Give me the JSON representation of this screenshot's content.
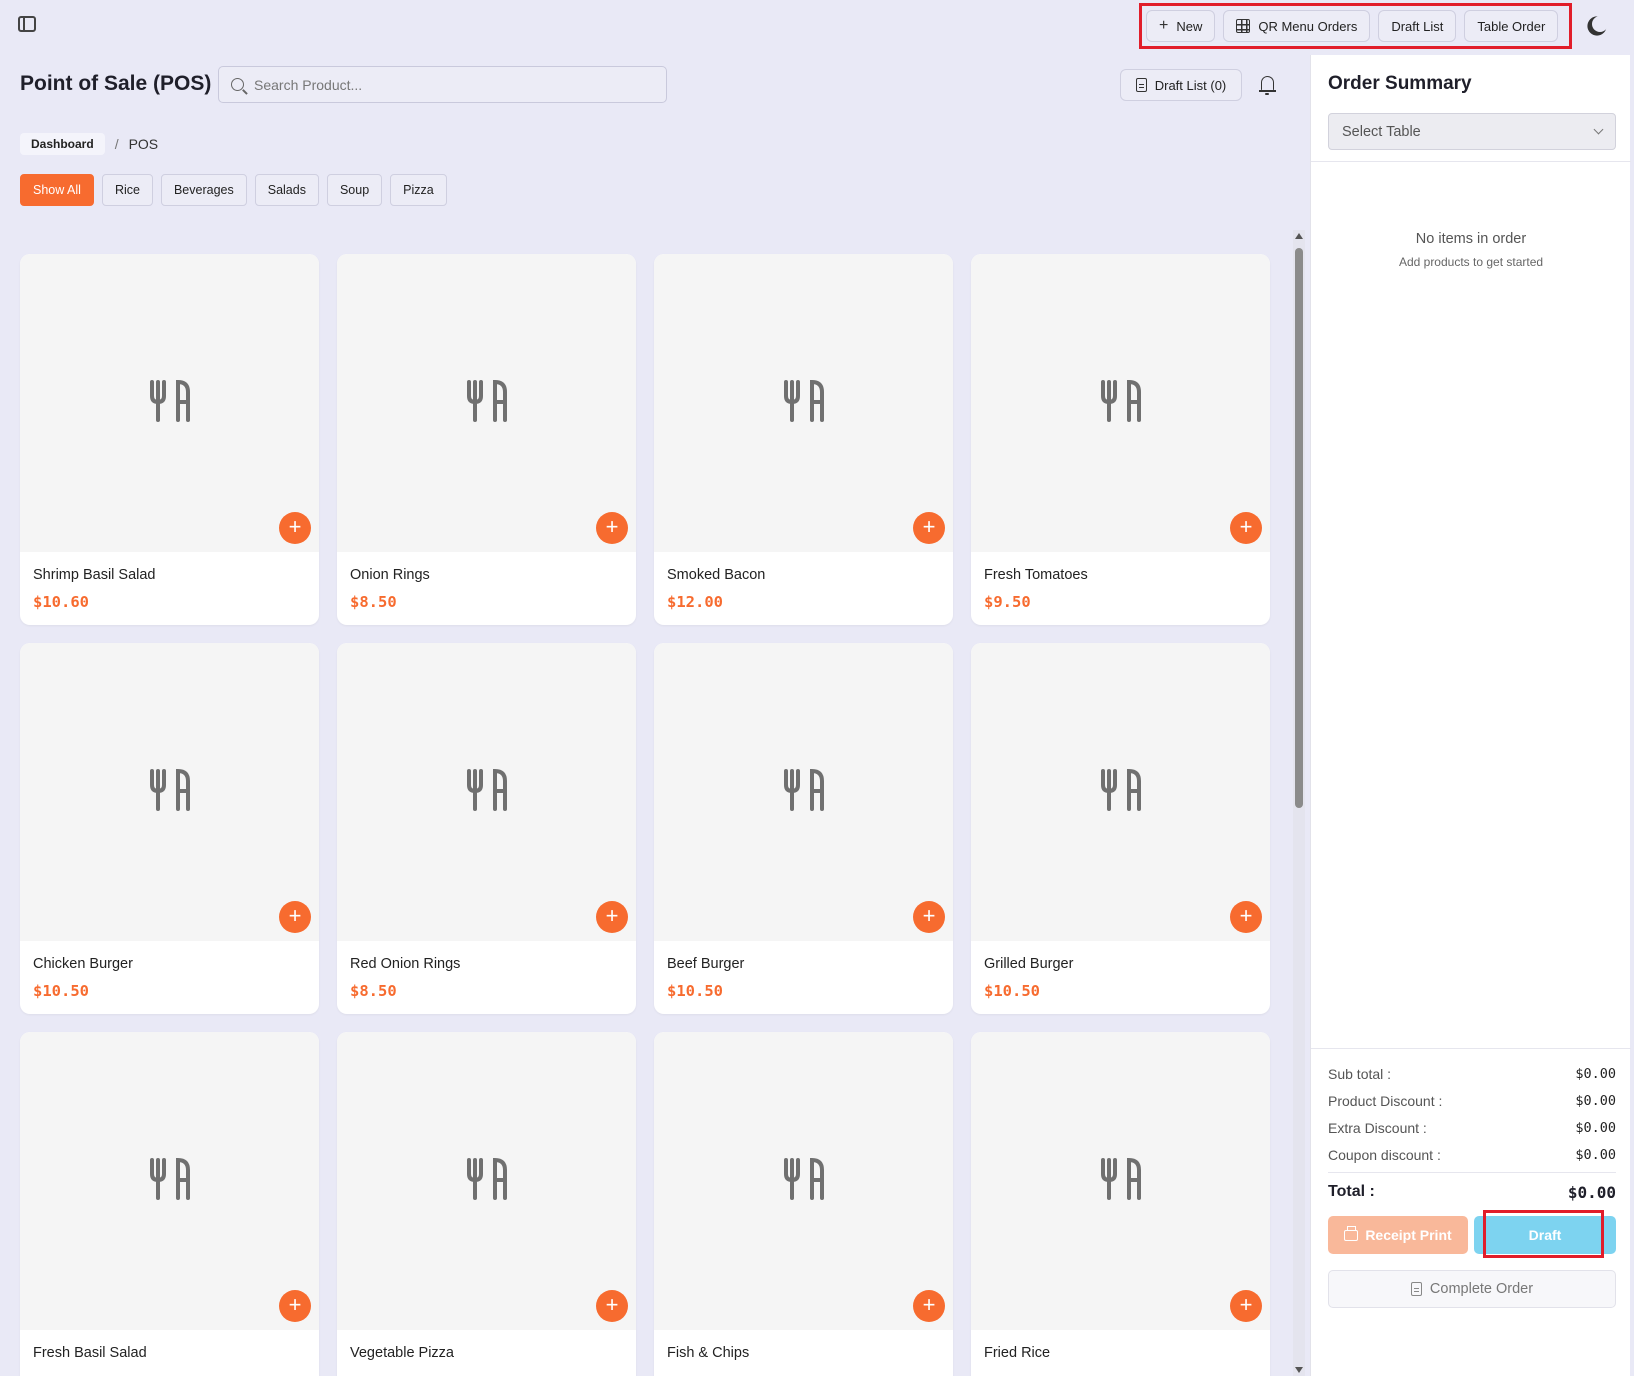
{
  "topbar": {
    "buttons": {
      "new": "New",
      "qr_menu_orders": "QR Menu Orders",
      "draft_list": "Draft List",
      "table_order": "Table Order"
    }
  },
  "header": {
    "title": "Point of Sale (POS)",
    "search_placeholder": "Search Product...",
    "draft_list_button": "Draft List (0)"
  },
  "breadcrumb": {
    "home": "Dashboard",
    "separator": "/",
    "current": "POS"
  },
  "categories": [
    "Show All",
    "Rice",
    "Beverages",
    "Salads",
    "Soup",
    "Pizza"
  ],
  "active_category": "Show All",
  "products": [
    {
      "name": "Shrimp Basil Salad",
      "price": "$10.60"
    },
    {
      "name": "Onion Rings",
      "price": "$8.50"
    },
    {
      "name": "Smoked Bacon",
      "price": "$12.00"
    },
    {
      "name": "Fresh Tomatoes",
      "price": "$9.50"
    },
    {
      "name": "Chicken Burger",
      "price": "$10.50"
    },
    {
      "name": "Red Onion Rings",
      "price": "$8.50"
    },
    {
      "name": "Beef Burger",
      "price": "$10.50"
    },
    {
      "name": "Grilled Burger",
      "price": "$10.50"
    },
    {
      "name": "Fresh Basil Salad",
      "price": ""
    },
    {
      "name": "Vegetable Pizza",
      "price": ""
    },
    {
      "name": "Fish & Chips",
      "price": ""
    },
    {
      "name": "Fried Rice",
      "price": ""
    }
  ],
  "order_summary": {
    "title": "Order Summary",
    "table_select_placeholder": "Select Table",
    "empty_title": "No items in order",
    "empty_subtitle": "Add products to get started",
    "sub_total_label": "Sub total :",
    "sub_total_value": "$0.00",
    "product_discount_label": "Product Discount :",
    "product_discount_value": "$0.00",
    "extra_discount_label": "Extra Discount :",
    "extra_discount_value": "$0.00",
    "coupon_discount_label": "Coupon discount :",
    "coupon_discount_value": "$0.00",
    "total_label": "Total :",
    "total_value": "$0.00",
    "receipt_print_label": "Receipt Print",
    "draft_label": "Draft",
    "complete_order_label": "Complete Order"
  },
  "colors": {
    "accent": "#f76b2f",
    "draft_button": "#7dd3f0",
    "highlight_box": "#e11d2a",
    "page_background": "#e9e9f6"
  }
}
